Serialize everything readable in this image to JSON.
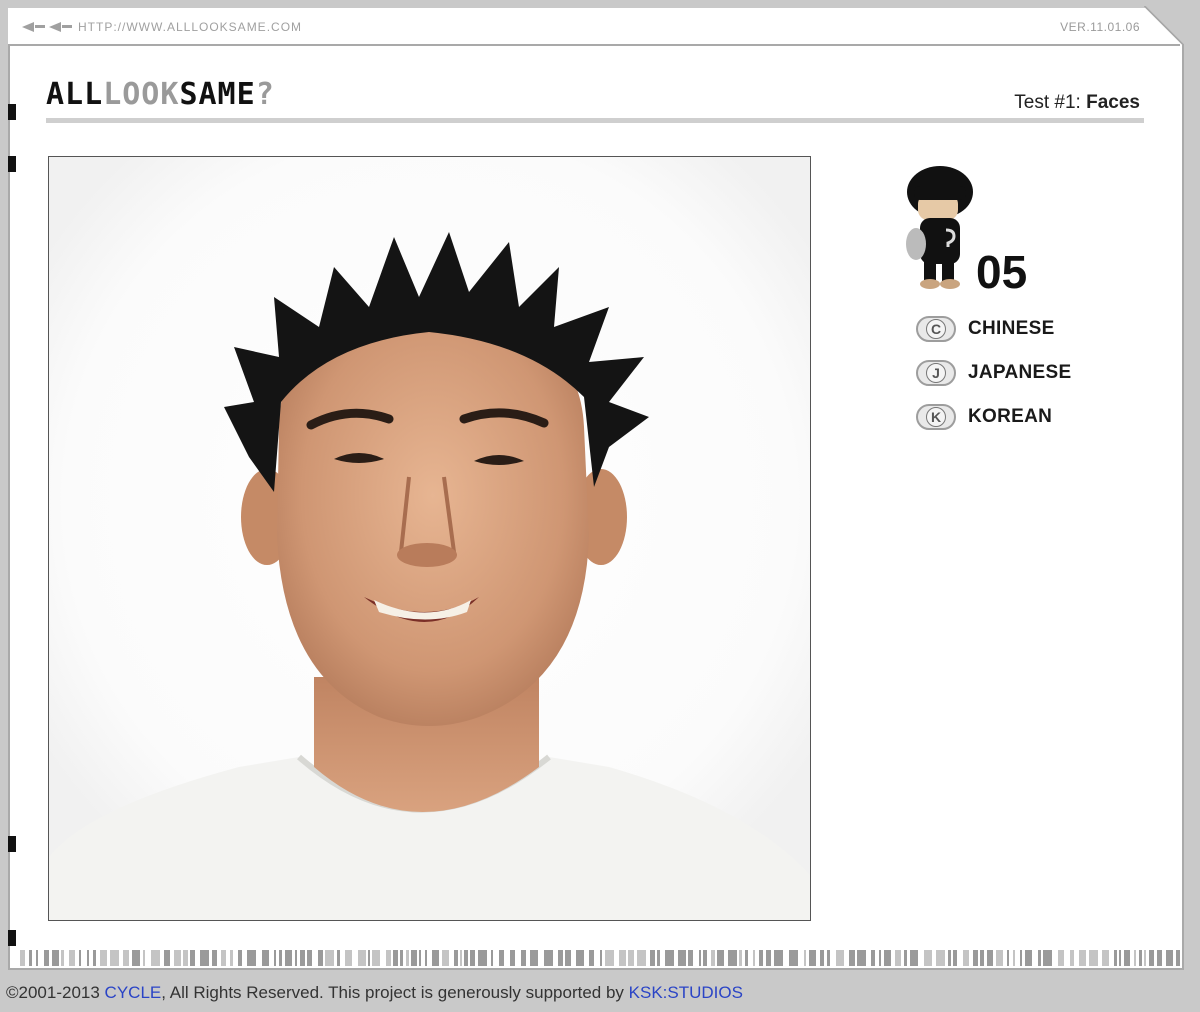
{
  "url_bar": {
    "url": "HTTP://WWW.ALLLOOKSAME.COM",
    "version": "VER.11.01.06"
  },
  "header": {
    "logo_part1": "ALL",
    "logo_part2": "LOOK",
    "logo_part3": "SAME",
    "logo_part4": "?",
    "test_label": "Test #1: ",
    "test_name": "Faces"
  },
  "photo": {
    "subject": "portrait-photo"
  },
  "sidebar": {
    "score": "05",
    "choices": [
      {
        "key": "C",
        "label": "CHINESE"
      },
      {
        "key": "J",
        "label": "JAPANESE"
      },
      {
        "key": "K",
        "label": "KOREAN"
      }
    ]
  },
  "footer": {
    "prefix": "©2001-2013 ",
    "link1": "CYCLE",
    "middle": ", All Rights Reserved. This project is generously supported by ",
    "link2": "KSK:STUDIOS"
  },
  "colors": {
    "frame": "#a9a9a9",
    "background": "#c9c9c9",
    "link": "#2a44c6"
  }
}
